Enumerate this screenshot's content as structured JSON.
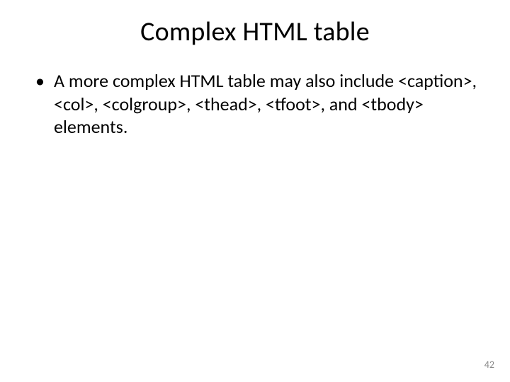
{
  "slide": {
    "title": "Complex HTML table",
    "bullets": [
      "A more complex HTML table may also include <caption>, <col>, <colgroup>, <thead>, <tfoot>, and <tbody> elements."
    ],
    "page_number": "42"
  }
}
